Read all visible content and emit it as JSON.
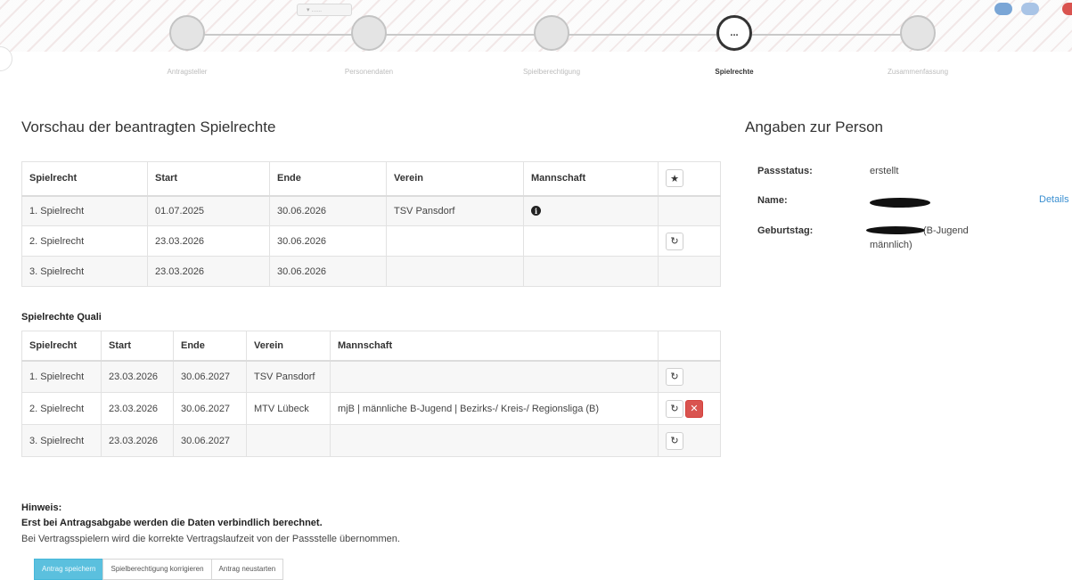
{
  "wizard": {
    "steps": [
      {
        "label": "Antragsteller"
      },
      {
        "label": "Personendaten"
      },
      {
        "label": "Spielberechtigung"
      },
      {
        "label": "Spielrechte",
        "marker": "..."
      },
      {
        "label": "Zusammenfassung"
      }
    ],
    "active_step": 4
  },
  "preview": {
    "title": "Vorschau der beantragten Spielrechte",
    "columns": [
      "Spielrecht",
      "Start",
      "Ende",
      "Verein",
      "Mannschaft",
      "★"
    ],
    "rows": [
      {
        "spielrecht": "1. Spielrecht",
        "start": "01.07.2025",
        "ende": "30.06.2026",
        "verein": "TSV Pansdorf",
        "mannschaft_icon": "info-icon"
      },
      {
        "spielrecht": "2. Spielrecht",
        "start": "23.03.2026",
        "ende": "30.06.2026",
        "verein": "",
        "action_icon": "edit-icon"
      },
      {
        "spielrecht": "3. Spielrecht",
        "start": "23.03.2026",
        "ende": "30.06.2026",
        "verein": ""
      }
    ]
  },
  "quali": {
    "title": "Spielrechte Quali",
    "columns": [
      "Spielrecht",
      "Start",
      "Ende",
      "Verein",
      "Mannschaft",
      ""
    ],
    "rows": [
      {
        "spielrecht": "1. Spielrecht",
        "start": "23.03.2026",
        "ende": "30.06.2027",
        "verein": "TSV Pansdorf",
        "mannschaft": ""
      },
      {
        "spielrecht": "2. Spielrecht",
        "start": "23.03.2026",
        "ende": "30.06.2027",
        "verein": "MTV Lübeck",
        "mannschaft": "mjB | männliche B-Jugend | Bezirks-/ Kreis-/ Regionsliga (B)"
      },
      {
        "spielrecht": "3. Spielrecht",
        "start": "23.03.2026",
        "ende": "30.06.2027",
        "verein": "",
        "mannschaft": ""
      }
    ],
    "edit_symbol": "↻",
    "delete_symbol": "✕"
  },
  "person": {
    "title": "Angaben zur Person",
    "passstatus_label": "Passstatus:",
    "passstatus_value": "erstellt",
    "name_label": "Name:",
    "geburtstag_label": "Geburtstag:",
    "geburtstag_suffix": "(B-Jugend",
    "geburtstag_suffix2": "männlich)",
    "details_link": "Details"
  },
  "hint": {
    "title": "Hinweis:",
    "bold": "Erst bei Antragsabgabe werden die Daten verbindlich berechnet.",
    "text": "Bei Vertragsspielern wird die korrekte Vertragslaufzeit von der Passstelle übernommen."
  },
  "buttons": {
    "save": "Antrag speichern",
    "correct": "Spielberechtigung korrigieren",
    "restart": "Antrag neustarten"
  },
  "colors": {
    "primary": "#5bc0de",
    "danger": "#d9534f",
    "link": "#3a8fd1"
  }
}
